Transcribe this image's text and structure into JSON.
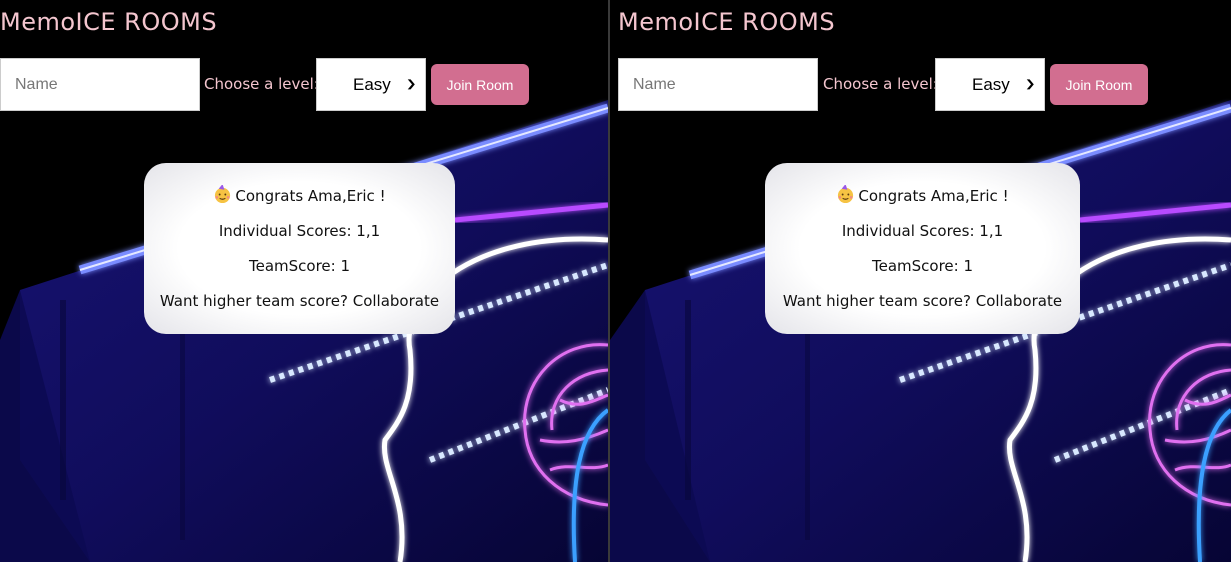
{
  "panels": [
    {
      "header": {
        "title": "MemoICE ROOMS"
      },
      "form": {
        "name_placeholder": "Name",
        "level_label": "Choose a level:",
        "level_selected": "Easy",
        "join_label": "Join Room"
      },
      "modal": {
        "icon": "party-face-icon",
        "congrats": "Congrats Ama,Eric !",
        "individual_scores": "Individual Scores: 1,1",
        "team_score": "TeamScore: 1",
        "tip": "Want higher team score? Collaborate"
      }
    },
    {
      "header": {
        "title": "MemoICE ROOMS"
      },
      "form": {
        "name_placeholder": "Name",
        "level_label": "Choose a level:",
        "level_selected": "Easy",
        "join_label": "Join Room"
      },
      "modal": {
        "icon": "party-face-icon",
        "congrats": "Congrats Ama,Eric !",
        "individual_scores": "Individual Scores: 1,1",
        "team_score": "TeamScore: 1",
        "tip": "Want higher team score? Collaborate"
      }
    }
  ],
  "colors": {
    "title": "#f4c6cf",
    "button": "#d26e90",
    "background": "#000000",
    "neon_blue": "#3c34ff",
    "neon_pink": "#e070f0"
  }
}
